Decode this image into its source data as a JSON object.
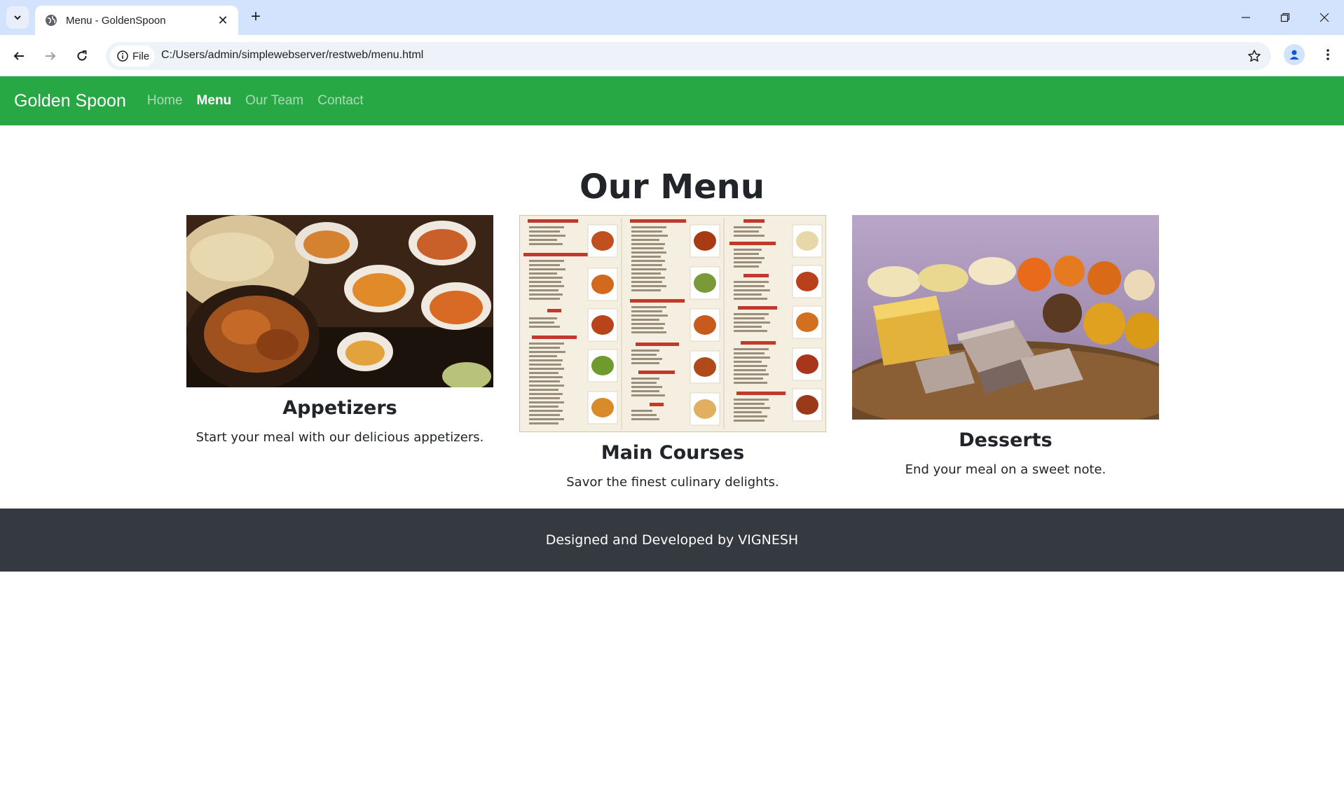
{
  "browser": {
    "tab_title": "Menu - GoldenSpoon",
    "site_chip": "File",
    "url": "C:/Users/admin/simplewebserver/restweb/menu.html"
  },
  "navbar": {
    "brand": "Golden Spoon",
    "links": [
      {
        "label": "Home",
        "active": false
      },
      {
        "label": "Menu",
        "active": true
      },
      {
        "label": "Our Team",
        "active": false
      },
      {
        "label": "Contact",
        "active": false
      }
    ]
  },
  "main": {
    "title": "Our Menu",
    "cards": [
      {
        "title": "Appetizers",
        "text": "Start your meal with our delicious appetizers.",
        "image": "appetizers-photo"
      },
      {
        "title": "Main Courses",
        "text": "Savor the finest culinary delights.",
        "image": "menu-card-photo"
      },
      {
        "title": "Desserts",
        "text": "End your meal on a sweet note.",
        "image": "sweets-photo"
      }
    ]
  },
  "footer": {
    "text": "Designed and Developed by VIGNESH"
  },
  "colors": {
    "navbar": "#28a745",
    "footer": "#343a40",
    "tabstrip": "#d3e3fd"
  }
}
